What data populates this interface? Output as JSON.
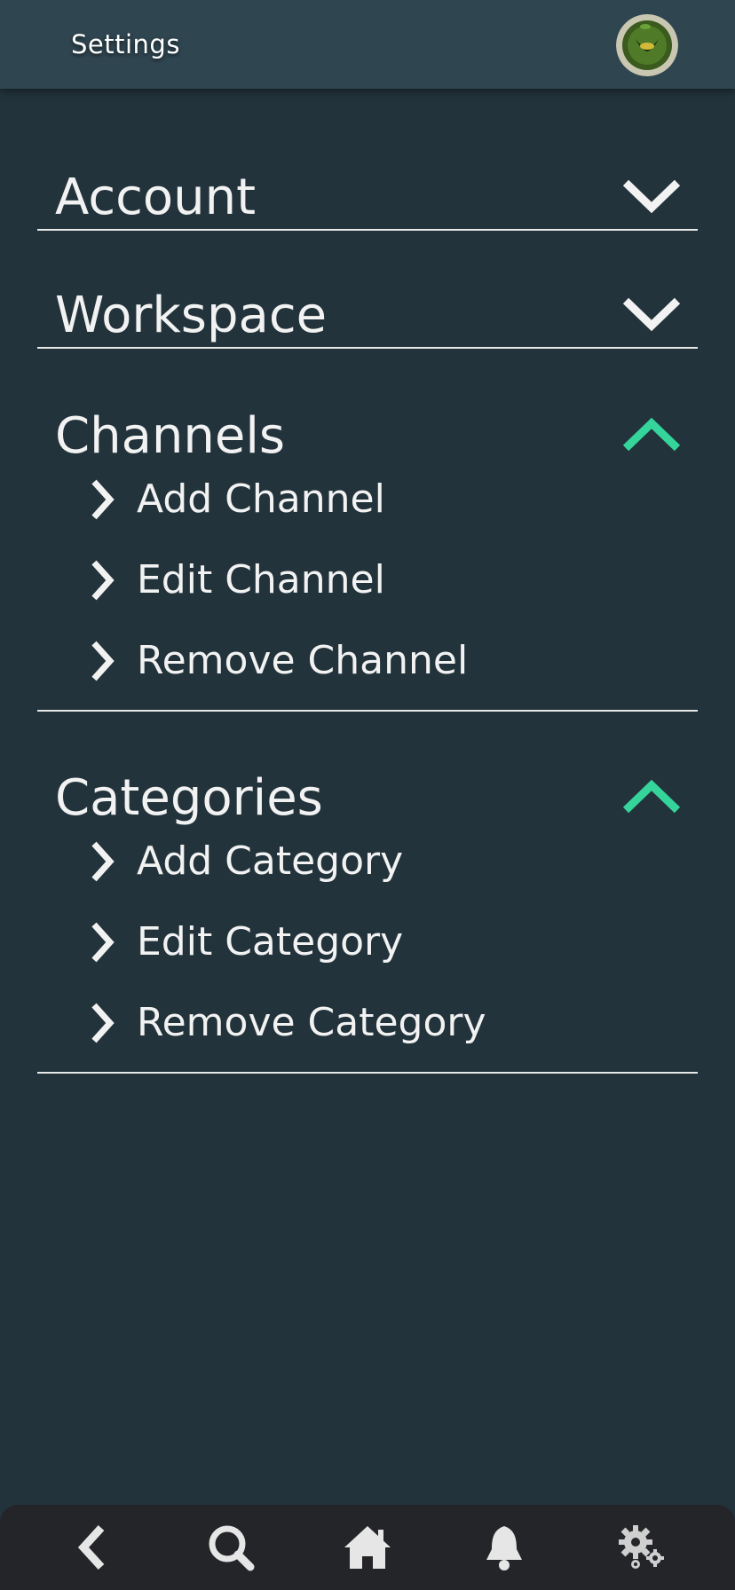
{
  "header": {
    "title": "Settings",
    "avatar_icon": "avatar-image"
  },
  "sections": [
    {
      "title": "Account",
      "expanded": false,
      "chevron_icon": "chevron-down-icon",
      "items": []
    },
    {
      "title": "Workspace",
      "expanded": false,
      "chevron_icon": "chevron-down-icon",
      "items": []
    },
    {
      "title": "Channels",
      "expanded": true,
      "chevron_icon": "chevron-up-icon",
      "items": [
        {
          "label": "Add Channel",
          "icon": "chevron-right-icon"
        },
        {
          "label": "Edit Channel",
          "icon": "chevron-right-icon"
        },
        {
          "label": "Remove Channel",
          "icon": "chevron-right-icon"
        }
      ]
    },
    {
      "title": "Categories",
      "expanded": true,
      "chevron_icon": "chevron-up-icon",
      "items": [
        {
          "label": "Add Category",
          "icon": "chevron-right-icon"
        },
        {
          "label": "Edit Category",
          "icon": "chevron-right-icon"
        },
        {
          "label": "Remove Category",
          "icon": "chevron-right-icon"
        }
      ]
    }
  ],
  "bottom_nav": {
    "items": [
      "back-icon",
      "search-icon",
      "home-icon",
      "bell-icon",
      "gears-icon"
    ]
  },
  "colors": {
    "background": "#22333b",
    "topbar": "#2f4550",
    "accent": "#35d49a",
    "text": "#f2f2f2",
    "bottom_nav": "#232528"
  }
}
